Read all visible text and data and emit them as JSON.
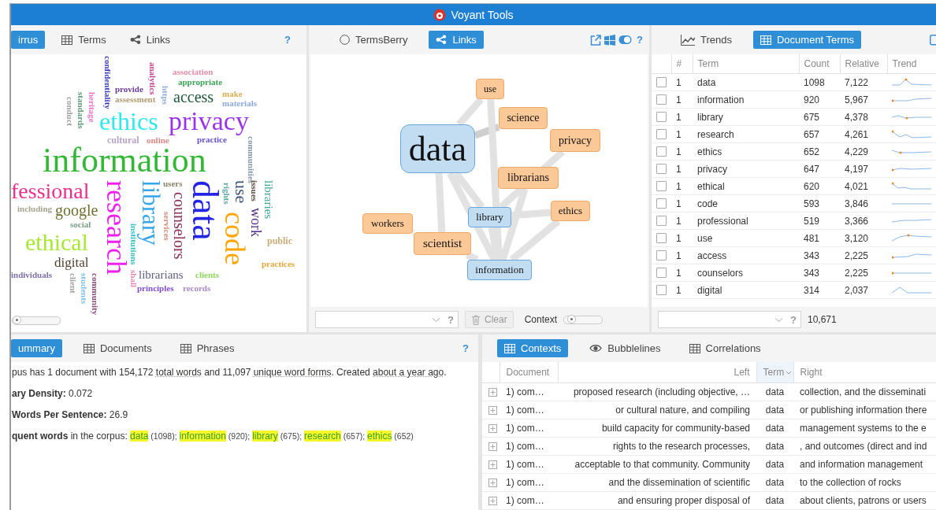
{
  "title": "Voyant Tools",
  "cirrus_panel": {
    "tabs": [
      {
        "label": "irrus",
        "selected": true
      },
      {
        "label": "Terms",
        "selected": false
      },
      {
        "label": "Links",
        "selected": false
      }
    ],
    "help": "?",
    "words": [
      {
        "text": "confidentiality",
        "color": "#3b3bc4"
      },
      {
        "text": "analytics",
        "color": "#c63d8f"
      },
      {
        "text": "association",
        "color": "#e48ea6"
      },
      {
        "text": "appropriate",
        "color": "#3aa655"
      },
      {
        "text": "conduct",
        "color": "#a0a0a0"
      },
      {
        "text": "standards",
        "color": "#5f9a78"
      },
      {
        "text": "heritage",
        "color": "#ee6fc8"
      },
      {
        "text": "provide",
        "color": "#6a3d9a"
      },
      {
        "text": "assessment",
        "color": "#b09c72"
      },
      {
        "text": "https",
        "color": "#8fb0d8"
      },
      {
        "text": "access",
        "color": "#1f5a3a"
      },
      {
        "text": "make",
        "color": "#d8ae50"
      },
      {
        "text": "materials",
        "color": "#8aaadc"
      },
      {
        "text": "ethics",
        "color": "#2ee8ee"
      },
      {
        "text": "privacy",
        "color": "#9a34ec"
      },
      {
        "text": "cultural",
        "color": "#b6a6c8"
      },
      {
        "text": "online",
        "color": "#d98a86"
      },
      {
        "text": "practice",
        "color": "#6650cc"
      },
      {
        "text": "communities",
        "color": "#8696a8"
      },
      {
        "text": "information",
        "color": "#33b836"
      },
      {
        "text": "fessional",
        "color": "#ec2f8f"
      },
      {
        "text": "research",
        "color": "#ee22ee"
      },
      {
        "text": "library",
        "color": "#35a6ea"
      },
      {
        "text": "users",
        "color": "#8a7f6a"
      },
      {
        "text": "counselors",
        "color": "#8e2f5a"
      },
      {
        "text": "data",
        "color": "#2424e6"
      },
      {
        "text": "rights",
        "color": "#5aa8a0"
      },
      {
        "text": "use",
        "color": "#3f5578"
      },
      {
        "text": "issues",
        "color": "#5a4a3a"
      },
      {
        "text": "libraries",
        "color": "#3fa89a"
      },
      {
        "text": "including",
        "color": "#a5a590"
      },
      {
        "text": "google",
        "color": "#6f6f2f"
      },
      {
        "text": "work",
        "color": "#4f2a86"
      },
      {
        "text": "services",
        "color": "#d08a7a"
      },
      {
        "text": "code",
        "color": "#ffa500"
      },
      {
        "text": "institutions",
        "color": "#33c0c0"
      },
      {
        "text": "social",
        "color": "#7aa086"
      },
      {
        "text": "ethical",
        "color": "#a6e832"
      },
      {
        "text": "public",
        "color": "#c8ae7a"
      },
      {
        "text": "digital",
        "color": "#4f3f2f"
      },
      {
        "text": "practices",
        "color": "#e0a83c"
      },
      {
        "text": "individuals",
        "color": "#7f6fa6"
      },
      {
        "text": "client",
        "color": "#a0a0a0"
      },
      {
        "text": "students",
        "color": "#7fbfe8"
      },
      {
        "text": "community",
        "color": "#8a4a7a"
      },
      {
        "text": "shall",
        "color": "#e68aae"
      },
      {
        "text": "librarians",
        "color": "#5f5f86"
      },
      {
        "text": "clients",
        "color": "#8cd45a"
      },
      {
        "text": "principles",
        "color": "#8050cc"
      },
      {
        "text": "records",
        "color": "#a58ac6"
      }
    ],
    "slider": {
      "level": 0
    }
  },
  "links_panel": {
    "tabs": [
      {
        "label": "TermsBerry",
        "selected": false
      },
      {
        "label": "Links",
        "selected": true
      }
    ],
    "help": "?",
    "nodes": [
      {
        "label": "data",
        "kind": "term"
      },
      {
        "label": "use",
        "kind": "collocate"
      },
      {
        "label": "science",
        "kind": "collocate"
      },
      {
        "label": "privacy",
        "kind": "collocate"
      },
      {
        "label": "librarians",
        "kind": "collocate"
      },
      {
        "label": "library",
        "kind": "term"
      },
      {
        "label": "ethics",
        "kind": "collocate"
      },
      {
        "label": "workers",
        "kind": "collocate"
      },
      {
        "label": "scientist",
        "kind": "collocate"
      },
      {
        "label": "information",
        "kind": "term"
      }
    ],
    "field_help": "?",
    "clear_button": {
      "label": "Clear",
      "disabled": true
    },
    "context_label": "Context",
    "context_slider": {
      "level": 0.1
    }
  },
  "terms_panel": {
    "tabs": [
      {
        "label": "Trends",
        "selected": false
      },
      {
        "label": "Document Terms",
        "selected": true
      }
    ],
    "columns": [
      "#",
      "Term",
      "Count",
      "Relative",
      "Trend"
    ],
    "rows": [
      {
        "checked": false,
        "rank": "1",
        "term": "data",
        "count": "1098",
        "relative": "7,122"
      },
      {
        "checked": false,
        "rank": "1",
        "term": "information",
        "count": "920",
        "relative": "5,967"
      },
      {
        "checked": false,
        "rank": "1",
        "term": "library",
        "count": "675",
        "relative": "4,378"
      },
      {
        "checked": false,
        "rank": "1",
        "term": "research",
        "count": "657",
        "relative": "4,261"
      },
      {
        "checked": false,
        "rank": "1",
        "term": "ethics",
        "count": "652",
        "relative": "4,229"
      },
      {
        "checked": false,
        "rank": "1",
        "term": "privacy",
        "count": "647",
        "relative": "4,197"
      },
      {
        "checked": false,
        "rank": "1",
        "term": "ethical",
        "count": "620",
        "relative": "4,021"
      },
      {
        "checked": false,
        "rank": "1",
        "term": "code",
        "count": "593",
        "relative": "3,846"
      },
      {
        "checked": false,
        "rank": "1",
        "term": "professional",
        "count": "519",
        "relative": "3,366"
      },
      {
        "checked": false,
        "rank": "1",
        "term": "use",
        "count": "481",
        "relative": "3,120"
      },
      {
        "checked": false,
        "rank": "1",
        "term": "access",
        "count": "343",
        "relative": "2,225"
      },
      {
        "checked": false,
        "rank": "1",
        "term": "counselors",
        "count": "343",
        "relative": "2,225"
      },
      {
        "checked": false,
        "rank": "1",
        "term": "digital",
        "count": "314",
        "relative": "2,037"
      }
    ],
    "field_help": "?",
    "total": "10,671"
  },
  "summary_panel": {
    "tabs": [
      {
        "label": "ummary",
        "selected": true
      },
      {
        "label": "Documents",
        "selected": false
      },
      {
        "label": "Phrases",
        "selected": false
      }
    ],
    "help": "?",
    "lines": [
      [
        {
          "text": "pus has 1 document with 154,172 ",
          "kind": "plain"
        },
        {
          "text": "total words",
          "kind": "hint"
        },
        {
          "text": " and 11,097 ",
          "kind": "plain"
        },
        {
          "text": "unique word forms",
          "kind": "hint"
        },
        {
          "text": ". Created ",
          "kind": "plain"
        },
        {
          "text": "about a year ago",
          "kind": "hint"
        },
        {
          "text": ".",
          "kind": "plain"
        }
      ],
      [
        {
          "text": "ary Density:",
          "kind": "bold"
        },
        {
          "text": " 0.072",
          "kind": "plain"
        }
      ],
      [
        {
          "text": "Words Per Sentence:",
          "kind": "bold"
        },
        {
          "text": " 26.9",
          "kind": "plain"
        }
      ],
      [
        {
          "text": "quent words",
          "kind": "bold"
        },
        {
          "text": " in the corpus: ",
          "kind": "plain"
        },
        {
          "text": "data",
          "kind": "term"
        },
        {
          "text": " (1098); ",
          "kind": "count"
        },
        {
          "text": "information",
          "kind": "term"
        },
        {
          "text": " (920); ",
          "kind": "count"
        },
        {
          "text": "library",
          "kind": "term"
        },
        {
          "text": " (675); ",
          "kind": "count"
        },
        {
          "text": "research",
          "kind": "term"
        },
        {
          "text": " (657); ",
          "kind": "count"
        },
        {
          "text": "ethics",
          "kind": "term"
        },
        {
          "text": " (652)",
          "kind": "count"
        }
      ]
    ]
  },
  "contexts_panel": {
    "tabs": [
      {
        "label": "Contexts",
        "selected": true
      },
      {
        "label": "Bubblelines",
        "selected": false
      },
      {
        "label": "Correlations",
        "selected": false
      }
    ],
    "columns": [
      "Document",
      "Left",
      "Term",
      "Right"
    ],
    "rows": [
      {
        "document": "1) com…",
        "left": "proposed research (including objective, …",
        "term": "data",
        "right": "collection, and the disseminati"
      },
      {
        "document": "1) com…",
        "left": "or cultural nature, and compiling",
        "term": "data",
        "right": "or publishing information there"
      },
      {
        "document": "1) com…",
        "left": "build capacity for community-based",
        "term": "data",
        "right": "management systems to the e"
      },
      {
        "document": "1) com…",
        "left": "rights to the research processes,",
        "term": "data",
        "right": ", and outcomes (direct and ind"
      },
      {
        "document": "1) com…",
        "left": "acceptable to that community. Community",
        "term": "data",
        "right": "and information management"
      },
      {
        "document": "1) com…",
        "left": "and the dissemination of scientific",
        "term": "data",
        "right": "to the collection of rocks"
      },
      {
        "document": "1) com…",
        "left": "and ensuring proper disposal of",
        "term": "data",
        "right": "about clients, patrons or users"
      }
    ]
  }
}
